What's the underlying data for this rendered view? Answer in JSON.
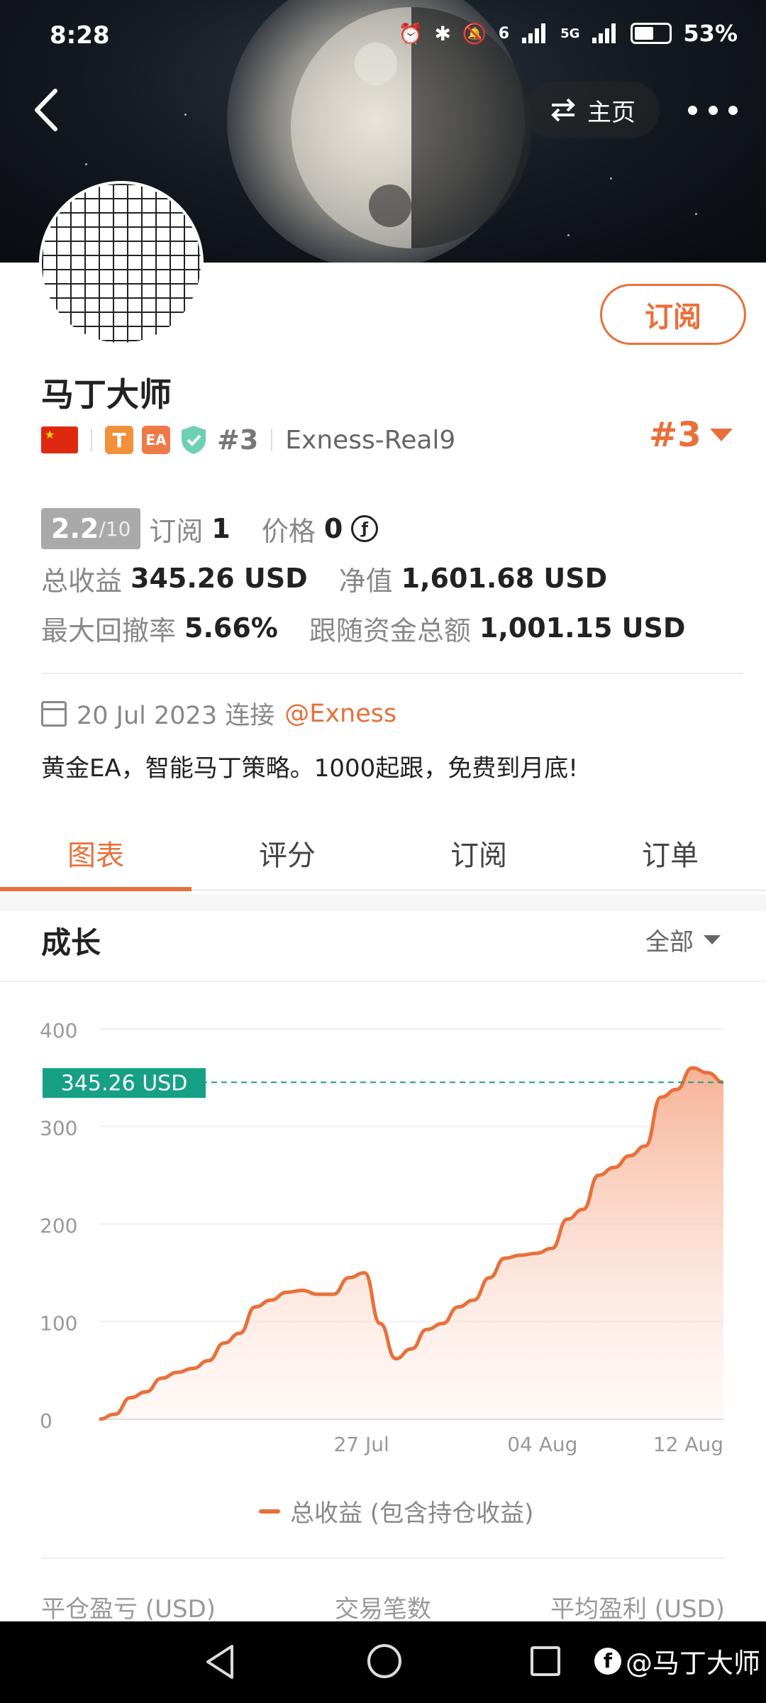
{
  "status": {
    "time": "8:28",
    "battery": "53%",
    "net1": "6",
    "net2": "5G"
  },
  "header": {
    "home_label": "主页"
  },
  "profile": {
    "subscribe_label": "订阅",
    "name": "马丁大师",
    "rank_small": "#3",
    "broker": "Exness-Real9",
    "rank_big": "#3",
    "badge_t": "T",
    "badge_ea": "EA"
  },
  "stats": {
    "score": "2.2",
    "score_max": "/10",
    "subscribe_label": "订阅",
    "subscribe_count": "1",
    "price_label": "价格",
    "price_value": "0",
    "coin_symbol": "ƒ",
    "total_profit_label": "总收益",
    "total_profit_value": "345.26 USD",
    "equity_label": "净值",
    "equity_value": "1,601.68 USD",
    "drawdown_label": "最大回撤率",
    "drawdown_value": "5.66%",
    "follow_label": "跟随资金总额",
    "follow_value": "1,001.15 USD"
  },
  "connection": {
    "date": "20 Jul 2023 连接",
    "link": "@Exness",
    "description": "黄金EA，智能马丁策略。1000起跟，免费到月底!"
  },
  "tabs": [
    {
      "label": "图表",
      "active": true
    },
    {
      "label": "评分",
      "active": false
    },
    {
      "label": "订阅",
      "active": false
    },
    {
      "label": "订单",
      "active": false
    }
  ],
  "growth": {
    "title": "成长",
    "range": "全部"
  },
  "chart_data": {
    "type": "area",
    "title": "",
    "xlabel": "",
    "ylabel": "",
    "ylim": [
      0,
      400
    ],
    "yticks": [
      0,
      100,
      200,
      300,
      400
    ],
    "xticks": [
      "27 Jul",
      "04 Aug",
      "12 Aug"
    ],
    "current_label": "345.26 USD",
    "current_value": 345.26,
    "colors": {
      "line": "#e8703a",
      "fill_top": "#f6a98a",
      "ref_line": "#1a9e88",
      "label_bg": "#16a085"
    },
    "series": [
      {
        "name": "总收益 (包含持仓收益)",
        "values": [
          0,
          5,
          22,
          28,
          42,
          48,
          52,
          60,
          78,
          88,
          115,
          122,
          130,
          132,
          128,
          128,
          145,
          150,
          98,
          62,
          72,
          92,
          98,
          115,
          122,
          145,
          165,
          168,
          170,
          175,
          205,
          215,
          250,
          258,
          270,
          280,
          330,
          338,
          360,
          355,
          345.26
        ]
      }
    ]
  },
  "legend": {
    "label": "总收益 (包含持仓收益)"
  },
  "footer": {
    "col1": "平仓盈亏 (USD)",
    "col2": "交易笔数",
    "col3": "平均盈利 (USD)"
  },
  "watermark": {
    "text": "@马丁大师",
    "fb": "f"
  }
}
